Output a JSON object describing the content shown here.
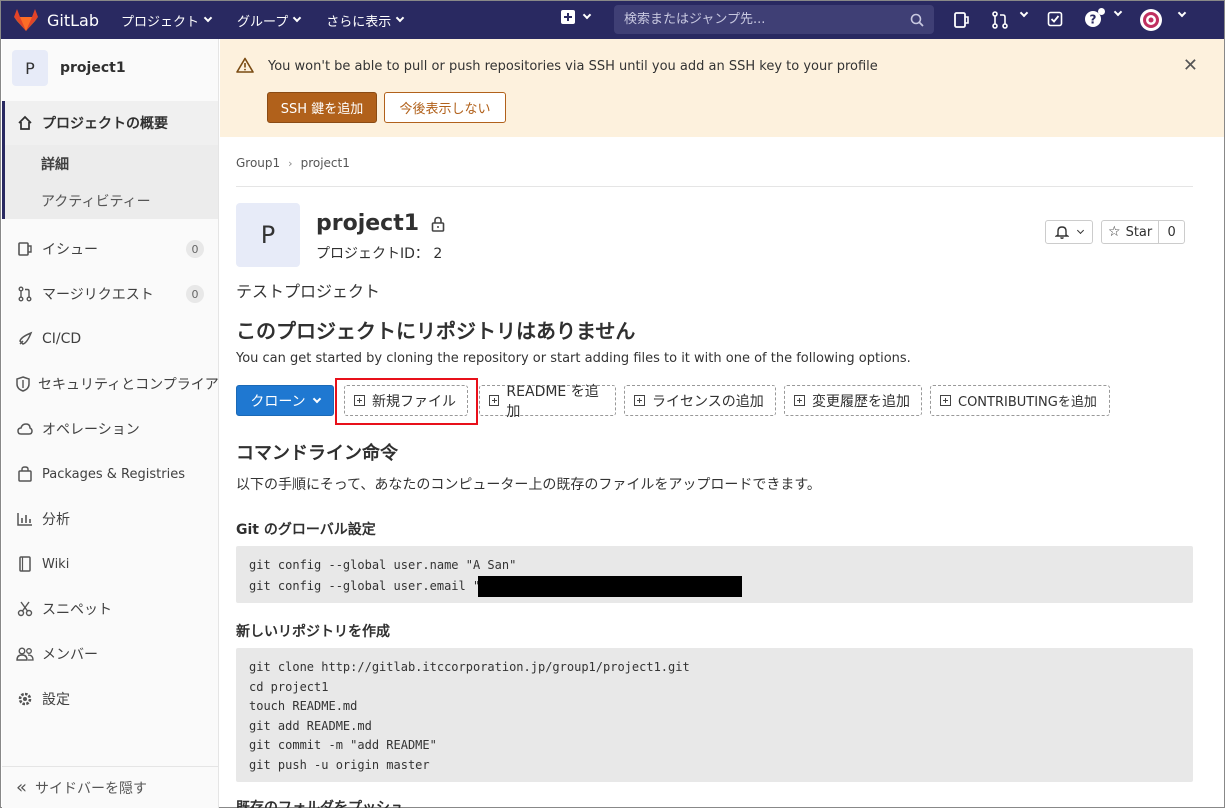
{
  "topbar": {
    "brand": "GitLab",
    "menu": [
      {
        "label": "プロジェクト"
      },
      {
        "label": "グループ"
      },
      {
        "label": "さらに表示"
      }
    ],
    "search_placeholder": "検索またはジャンプ先...",
    "colors": {
      "navbar": "#292961",
      "accent": "#1f78d1"
    }
  },
  "sidebar": {
    "project_avatar": "P",
    "project_name": "project1",
    "items": [
      {
        "label": "プロジェクトの概要",
        "icon": "home-icon"
      },
      {
        "label": "詳細"
      },
      {
        "label": "アクティビティー"
      },
      {
        "label": "イシュー",
        "icon": "issues-icon",
        "count": "0"
      },
      {
        "label": "マージリクエスト",
        "icon": "merge-request-icon",
        "count": "0"
      },
      {
        "label": "CI/CD",
        "icon": "rocket-icon"
      },
      {
        "label": "セキュリティとコンプライアンス",
        "icon": "shield-icon"
      },
      {
        "label": "オペレーション",
        "icon": "cloud-icon"
      },
      {
        "label": "Packages & Registries",
        "icon": "package-icon"
      },
      {
        "label": "分析",
        "icon": "chart-icon"
      },
      {
        "label": "Wiki",
        "icon": "book-icon"
      },
      {
        "label": "スニペット",
        "icon": "scissors-icon"
      },
      {
        "label": "メンバー",
        "icon": "users-icon"
      },
      {
        "label": "設定",
        "icon": "gear-icon"
      }
    ],
    "collapse_label": "サイドバーを隠す"
  },
  "alert": {
    "message": "You won't be able to pull or push repositories via SSH until you add an SSH key to your profile",
    "primary_button": "SSH 鍵を追加",
    "secondary_button": "今後表示しない"
  },
  "breadcrumb": [
    "Group1",
    "project1"
  ],
  "project": {
    "avatar": "P",
    "title": "project1",
    "id_label": "プロジェクトID： 2",
    "star_label": "Star",
    "star_count": "0",
    "description": "テストプロジェクト"
  },
  "empty": {
    "heading": "このプロジェクトにリポジトリはありません",
    "text": "You can get started by cloning the repository or start adding files to it with one of the following options."
  },
  "actions": {
    "clone": "クローン",
    "new_file": "新規ファイル",
    "add_readme": "README を追加",
    "add_license": "ライセンスの追加",
    "add_changelog": "変更履歴を追加",
    "add_contributing": "CONTRIBUTINGを追加"
  },
  "commands": {
    "heading": "コマンドライン命令",
    "intro": "以下の手順にそって、あなたのコンピューター上の既存のファイルをアップロードできます。",
    "global_heading": "Git のグローバル設定",
    "global_line1": "git config --global user.name \"A San\"",
    "global_line2": "git config --global user.email \"",
    "new_repo_heading": "新しいリポジトリを作成",
    "new_repo_lines": [
      "git clone http://gitlab.itccorporation.jp/group1/project1.git",
      "cd project1",
      "touch README.md",
      "git add README.md",
      "git commit -m \"add README\"",
      "git push -u origin master"
    ],
    "push_folder_heading": "既存のフォルダをプッシュ"
  }
}
